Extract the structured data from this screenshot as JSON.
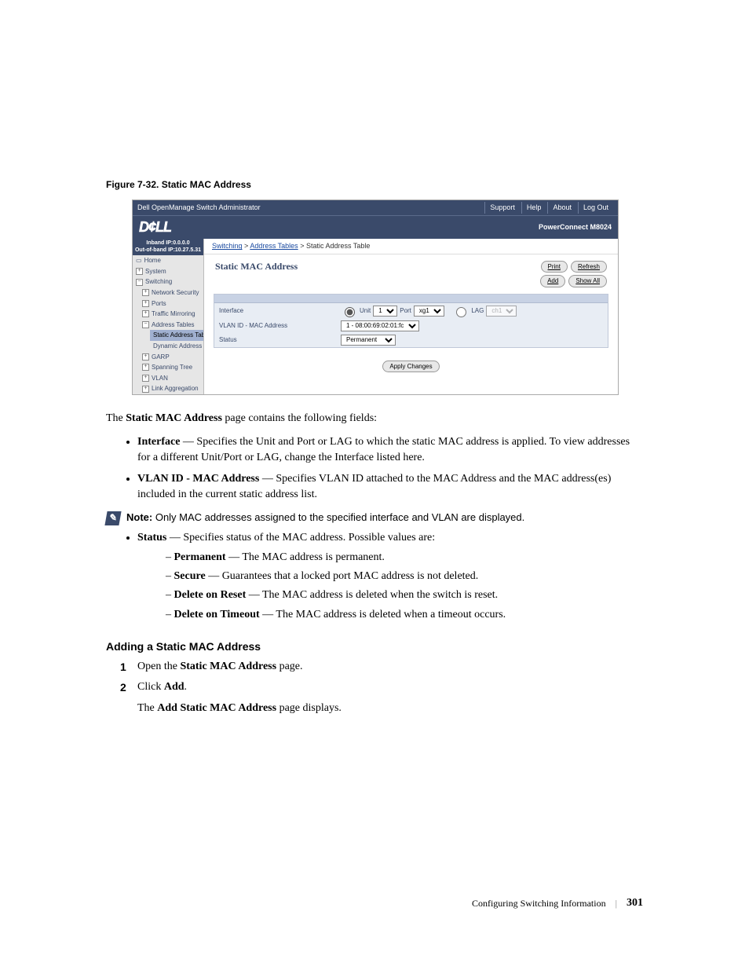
{
  "figure_caption": "Figure 7-32.    Static MAC Address",
  "titlebar": {
    "left": "Dell OpenManage Switch Administrator",
    "links": {
      "support": "Support",
      "help": "Help",
      "about": "About",
      "logout": "Log Out"
    }
  },
  "logobar": {
    "logo": "D¢LL",
    "product": "PowerConnect M8024"
  },
  "ipbox": {
    "line1": "Inband IP:0.0.0.0",
    "line2": "Out-of-band IP:10.27.5.31"
  },
  "nav": {
    "home": "Home",
    "system": "System",
    "switching": "Switching",
    "network_security": "Network Security",
    "ports": "Ports",
    "traffic_mirroring": "Traffic Mirroring",
    "address_tables": "Address Tables",
    "static_address_table": "Static Address Tab",
    "dynamic_address_table": "Dynamic Address T",
    "garp": "GARP",
    "spanning_tree": "Spanning Tree",
    "vlan": "VLAN",
    "link_aggregation": "Link Aggregation"
  },
  "breadcrumb": {
    "a": "Switching",
    "b": "Address Tables",
    "c": "Static Address Table",
    "sep": " > "
  },
  "panel": {
    "title": "Static MAC Address",
    "buttons": {
      "print": "Print",
      "refresh": "Refresh",
      "add": "Add",
      "show_all": "Show All"
    },
    "rows": {
      "interface": {
        "label": "Interface",
        "unit_label": "Unit",
        "unit_value": "1",
        "port_label": "Port",
        "port_value": "xg1",
        "lag_label": "LAG",
        "lag_value": "ch1"
      },
      "vlan_mac": {
        "label": "VLAN ID - MAC Address",
        "value": "1 - 08:00:69:02:01:fc"
      },
      "status": {
        "label": "Status",
        "value": "Permanent"
      }
    },
    "apply": "Apply Changes"
  },
  "body": {
    "intro_a": "The ",
    "intro_b": "Static MAC Address",
    "intro_c": " page contains the following fields:",
    "li1_a": "Interface",
    "li1_b": " — Specifies the Unit and Port or LAG to which the static MAC address is applied. To view addresses for a different Unit/Port or LAG, change the Interface listed here.",
    "li2_a": "VLAN ID - MAC Address",
    "li2_b": " — Specifies VLAN ID attached to the MAC Address and the MAC address(es) included in the current static address list.",
    "note_label": "Note:",
    "note_text": " Only MAC addresses assigned to the specified interface and VLAN are displayed.",
    "li3_a": "Status",
    "li3_b": " — Specifies status of the MAC address. Possible values are:",
    "s1a": "Permanent",
    "s1b": " — The MAC address is permanent.",
    "s2a": "Secure",
    "s2b": " — Guarantees that a locked port MAC address is not deleted.",
    "s3a": "Delete on Reset",
    "s3b": " — The MAC address is deleted when the switch is reset.",
    "s4a": "Delete on Timeout",
    "s4b": " — The MAC address is deleted when a timeout occurs."
  },
  "section_heading": "Adding a Static MAC Address",
  "steps": {
    "one_a": "Open the ",
    "one_b": "Static MAC Address",
    "one_c": " page.",
    "two_a": "Click ",
    "two_b": "Add",
    "two_c": ".",
    "two_sub_a": "The ",
    "two_sub_b": "Add Static MAC Address",
    "two_sub_c": " page displays."
  },
  "footer": {
    "chapter": "Configuring Switching Information",
    "page": "301"
  }
}
